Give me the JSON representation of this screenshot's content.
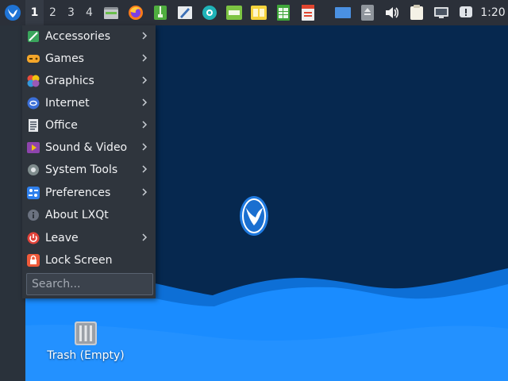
{
  "taskbar": {
    "start_icon": "lxqt-bird-icon",
    "desktops": [
      "1",
      "2",
      "3",
      "4"
    ],
    "active_desktop": "1",
    "launchers": [
      "file-manager-icon",
      "firefox-icon",
      "archive-manager-icon",
      "text-editor-icon",
      "settings-gear-icon",
      "game-2048-icon",
      "game-mahjong-icon",
      "spreadsheet-icon",
      "document-viewer-icon"
    ],
    "tray": [
      "show-desktop-icon",
      "usb-drive-icon",
      "volume-icon",
      "clipboard-icon",
      "network-icon",
      "notification-icon"
    ],
    "clock": "1:20"
  },
  "menu": {
    "items": [
      {
        "label": "Accessories",
        "icon": "accessories-icon",
        "submenu": true
      },
      {
        "label": "Games",
        "icon": "gamepad-icon",
        "submenu": true
      },
      {
        "label": "Graphics",
        "icon": "graphics-icon",
        "submenu": true
      },
      {
        "label": "Internet",
        "icon": "internet-globe-icon",
        "submenu": true
      },
      {
        "label": "Office",
        "icon": "office-document-icon",
        "submenu": true
      },
      {
        "label": "Sound & Video",
        "icon": "multimedia-icon",
        "submenu": true
      },
      {
        "label": "System Tools",
        "icon": "system-tools-gear-icon",
        "submenu": true
      },
      {
        "label": "Preferences",
        "icon": "preferences-icon",
        "submenu": true
      },
      {
        "label": "About LXQt",
        "icon": "info-icon",
        "submenu": false
      },
      {
        "label": "Leave",
        "icon": "power-icon",
        "submenu": true
      },
      {
        "label": "Lock Screen",
        "icon": "lock-icon",
        "submenu": false
      }
    ],
    "search_placeholder": "Search..."
  },
  "desktop": {
    "trash_label": "Trash (Empty)",
    "wallpaper_logo": "lxqt-bird-icon",
    "colors": {
      "background": "#06284f",
      "wave": "#1a8cff"
    }
  }
}
